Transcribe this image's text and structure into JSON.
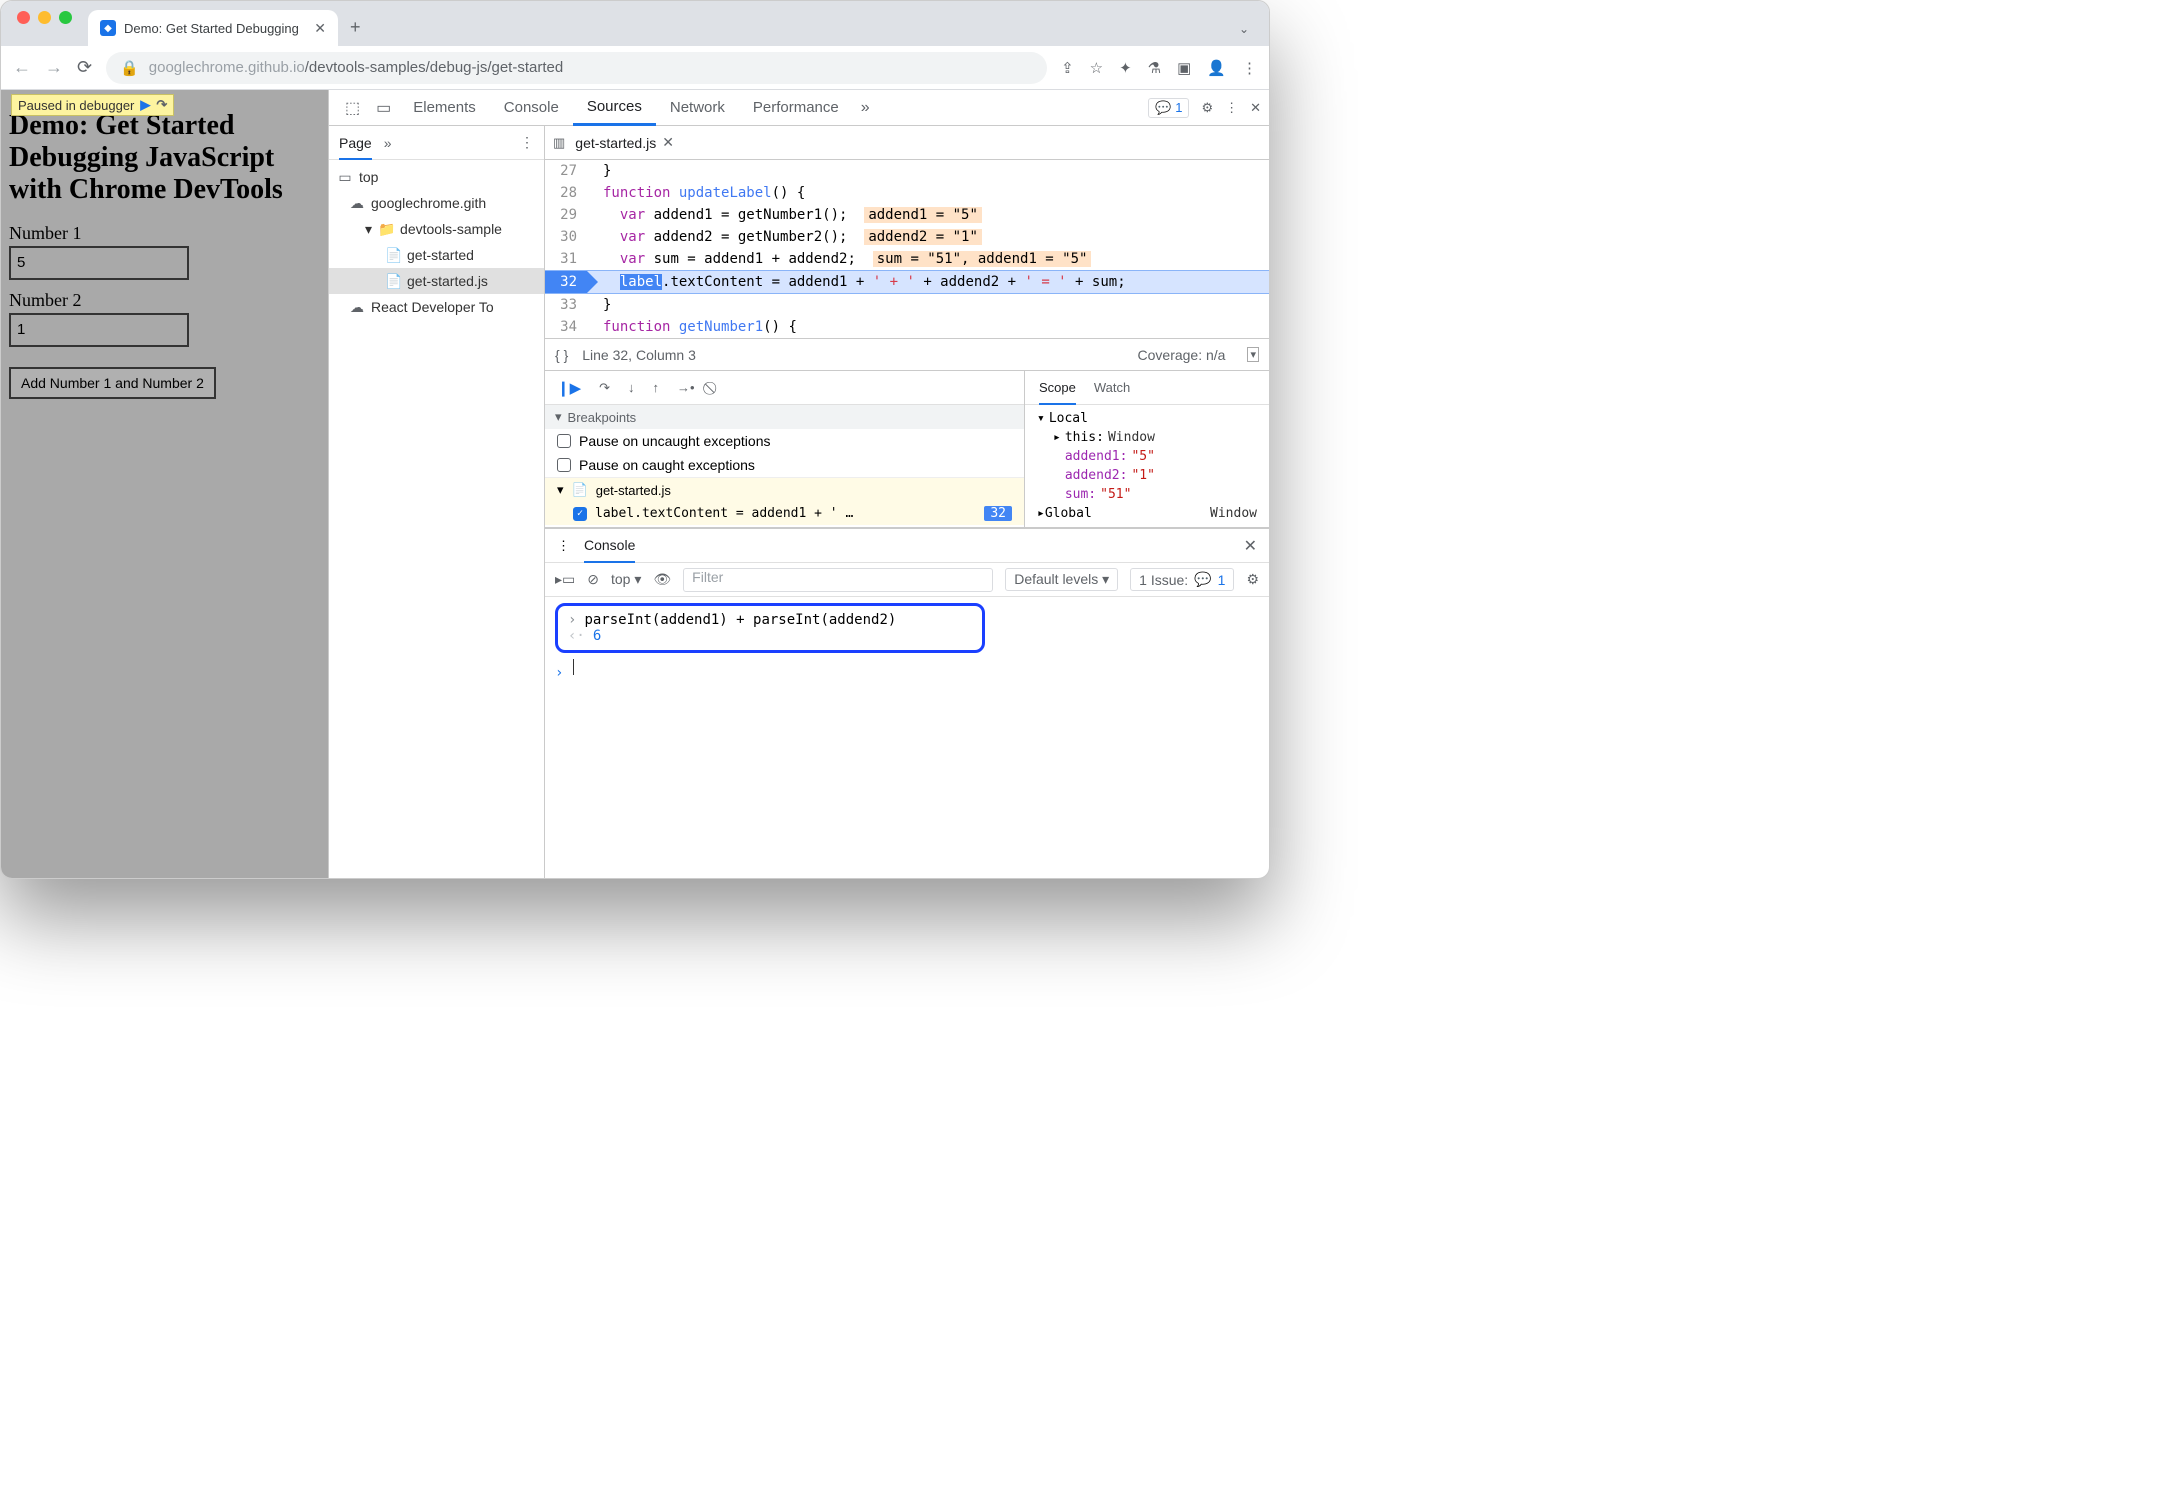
{
  "browser": {
    "tab_title": "Demo: Get Started Debugging",
    "url_host": "googlechrome.github.io",
    "url_path": "/devtools-samples/debug-js/get-started"
  },
  "overlay": {
    "paused": "Paused in debugger"
  },
  "page": {
    "heading": "Demo: Get Started Debugging JavaScript with Chrome DevTools",
    "label1": "Number 1",
    "value1": "5",
    "label2": "Number 2",
    "value2": "1",
    "button": "Add Number 1 and Number 2"
  },
  "devtools": {
    "tabs": [
      "Elements",
      "Console",
      "Sources",
      "Network",
      "Performance"
    ],
    "active_tab": "Sources",
    "issue_count": "1"
  },
  "navigator": {
    "tab": "Page",
    "top": "top",
    "domain": "googlechrome.gith",
    "folder": "devtools-sample",
    "files": [
      "get-started",
      "get-started.js"
    ],
    "extension": "React Developer To"
  },
  "editor": {
    "filename": "get-started.js",
    "lines": [
      {
        "n": 27,
        "html": "}"
      },
      {
        "n": 28,
        "html": "<span class='kw'>function</span> <span class='fn'>updateLabel</span>() {"
      },
      {
        "n": 29,
        "html": "  <span class='kw'>var</span> addend1 = getNumber1();",
        "hint": "addend1 = \"5\""
      },
      {
        "n": 30,
        "html": "  <span class='kw'>var</span> addend2 = getNumber2();",
        "hint": "addend2 = \"1\""
      },
      {
        "n": 31,
        "html": "  <span class='kw'>var</span> sum = addend1 + addend2;",
        "hint": "sum = \"51\", addend1 = \"5\""
      },
      {
        "n": 32,
        "html": "  <span class='hl'>label</span>.textContent = addend1 + <span class='str'>' + '</span> + addend2 + <span class='str'>' = '</span> + sum;",
        "current": true
      },
      {
        "n": 33,
        "html": "}"
      },
      {
        "n": 34,
        "html": "<span class='kw'>function</span> <span class='fn'>getNumber1</span>() {"
      }
    ],
    "cursor": "Line 32, Column 3",
    "coverage": "Coverage: n/a"
  },
  "breakpoints": {
    "title": "Breakpoints",
    "pause_uncaught": "Pause on uncaught exceptions",
    "pause_caught": "Pause on caught exceptions",
    "file": "get-started.js",
    "code": "label.textContent = addend1 + ' …",
    "line": "32"
  },
  "scope": {
    "tabs": [
      "Scope",
      "Watch"
    ],
    "local": "Local",
    "this": "this: ",
    "this_val": "Window",
    "vars": [
      {
        "name": "addend1:",
        "val": "\"5\""
      },
      {
        "name": "addend2:",
        "val": "\"1\""
      },
      {
        "name": "sum:",
        "val": "\"51\""
      }
    ],
    "global": "Global",
    "global_val": "Window"
  },
  "console": {
    "title": "Console",
    "context": "top",
    "filter_placeholder": "Filter",
    "levels": "Default levels",
    "issues_label": "1 Issue:",
    "issues_count": "1",
    "input": "parseInt(addend1) + parseInt(addend2)",
    "output": "6"
  }
}
